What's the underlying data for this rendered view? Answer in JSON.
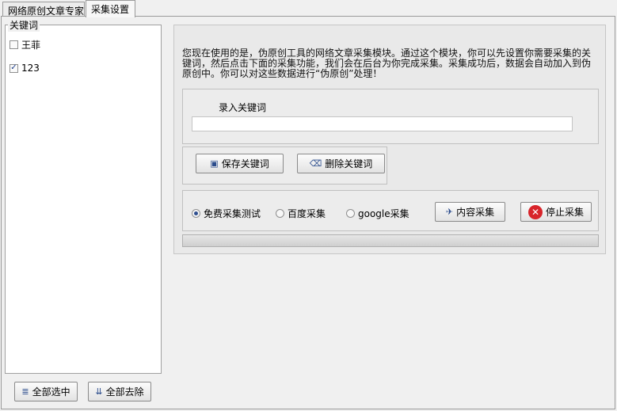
{
  "tabs": [
    {
      "label": "网络原创文章专家"
    },
    {
      "label": "采集设置"
    }
  ],
  "keywords": {
    "legend": "关键词",
    "items": [
      {
        "label": "王菲",
        "checked": false
      },
      {
        "label": "123",
        "checked": true
      }
    ],
    "select_all_label": "全部选中",
    "remove_all_label": "全部去除"
  },
  "intro_text": "您现在使用的是，伪原创工具的网络文章采集模块。通过这个模块，你可以先设置你需要采集的关键词，然后点击下面的采集功能，我们会在后台为你完成采集。采集成功后，数据会自动加入到伪原创中。你可以对这些数据进行“伪原创”处理！",
  "input": {
    "label": "录入关键词",
    "value": ""
  },
  "actions": {
    "save_label": "保存关键词",
    "delete_label": "删除关键词"
  },
  "source": {
    "options": [
      {
        "label": "免费采集测试",
        "selected": true
      },
      {
        "label": "百度采集",
        "selected": false
      },
      {
        "label": "google采集",
        "selected": false
      }
    ],
    "content_button_label": "内容采集",
    "stop_button_label": "停止采集"
  },
  "progress": {
    "value": 0
  }
}
